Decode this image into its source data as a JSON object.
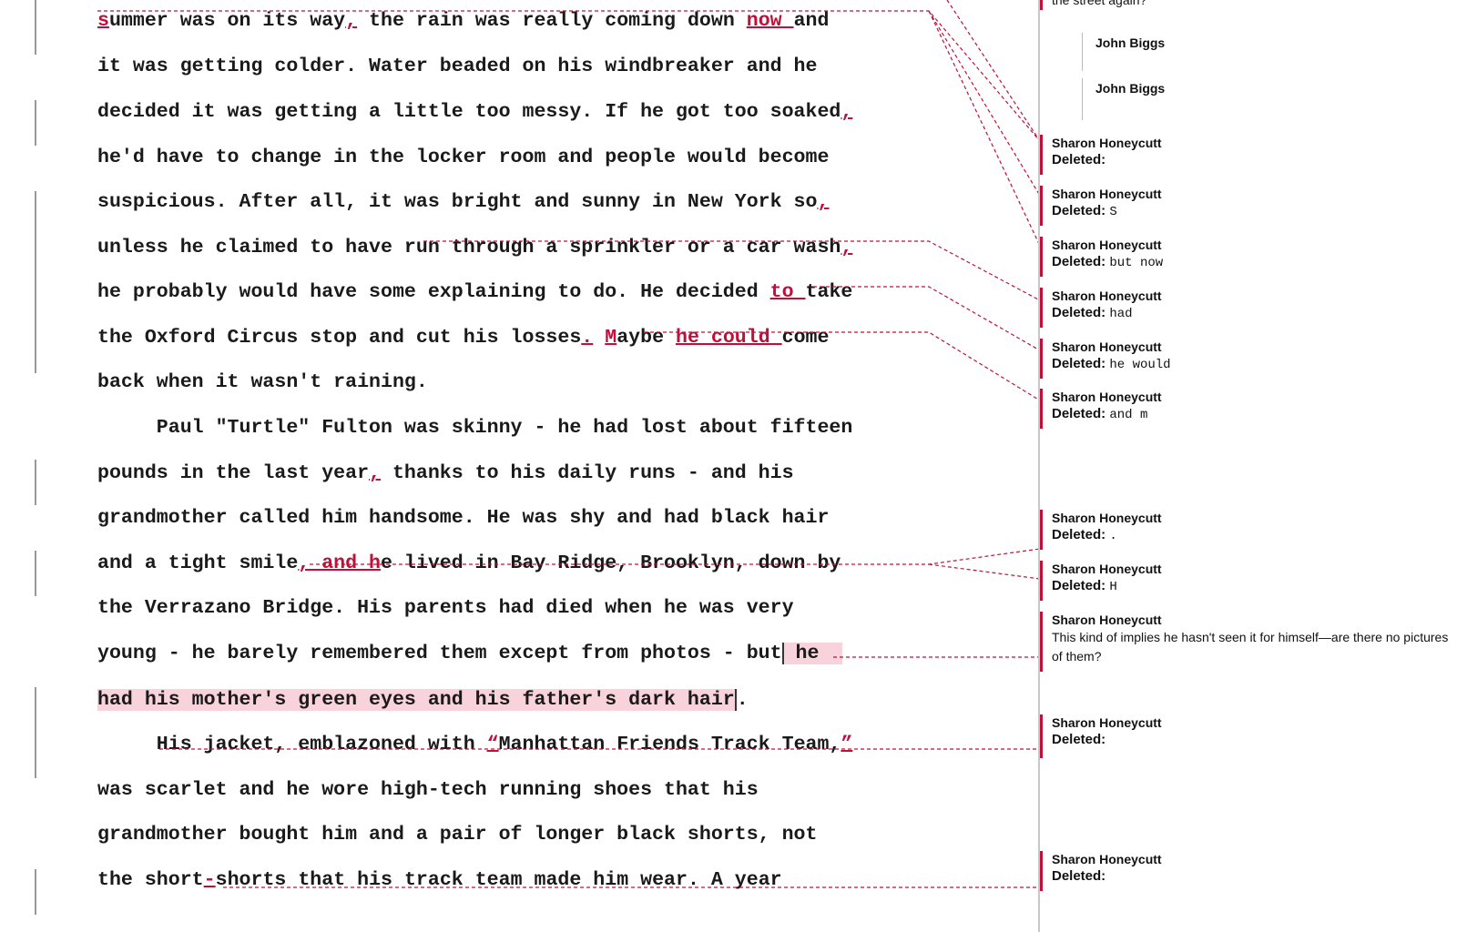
{
  "document": {
    "lines": [
      [
        {
          "t": "s",
          "ins": true
        },
        {
          "t": "ummer was on its way"
        },
        {
          "t": ",",
          "ins": true
        },
        {
          "t": " the rain was really coming down "
        },
        {
          "t": "now ",
          "ins": true
        },
        {
          "t": "and"
        }
      ],
      [
        {
          "t": "it was getting colder. Water beaded on his windbreaker and he"
        }
      ],
      [
        {
          "t": "decided it was getting a little too messy. If he got too soaked"
        },
        {
          "t": ",",
          "ins": true
        }
      ],
      [
        {
          "t": "he'd have to change in the locker room and people would become"
        }
      ],
      [
        {
          "t": "suspicious. After all, it was bright and sunny in New York so"
        },
        {
          "t": ",",
          "ins": true
        }
      ],
      [
        {
          "t": "unless he claimed to have run through a sprinkler or a car wash"
        },
        {
          "t": ",",
          "ins": true
        }
      ],
      [
        {
          "t": "he probably would have some explaining to do. He decided "
        },
        {
          "t": "to ",
          "ins": true
        },
        {
          "t": "take"
        }
      ],
      [
        {
          "t": "the Oxford Circus stop and cut his losses"
        },
        {
          "t": ".",
          "ins": true
        },
        {
          "t": " "
        },
        {
          "t": "M",
          "ins": true
        },
        {
          "t": "aybe "
        },
        {
          "t": "he could ",
          "ins": true
        },
        {
          "t": "come"
        }
      ],
      [
        {
          "t": "back when it wasn't raining."
        }
      ],
      [
        {
          "t": "     Paul \"Turtle\" Fulton was skinny - he had lost about fifteen"
        }
      ],
      [
        {
          "t": "pounds in the last year"
        },
        {
          "t": ",",
          "ins": true
        },
        {
          "t": " thanks to his daily runs - and his"
        }
      ],
      [
        {
          "t": "grandmother called him handsome. He was shy and had black hair"
        }
      ],
      [
        {
          "t": "and a tight smile"
        },
        {
          "t": ", and h",
          "ins": true
        },
        {
          "t": "e lived in Bay Ridge, Brooklyn, down by"
        }
      ],
      [
        {
          "t": "the Verrazano Bridge. His parents had died when he was very"
        }
      ],
      [
        {
          "t": "young - he barely remembered them except from photos - but"
        },
        {
          "t": " he  ",
          "hl": true,
          "cursor": true
        }
      ],
      [
        {
          "t": "had his mother's green eyes and his father's dark hair",
          "hl": true
        },
        {
          "t": ".",
          "cursor": true
        }
      ],
      [
        {
          "t": "     His jacket, emblazoned with "
        },
        {
          "t": "“",
          "ins": true
        },
        {
          "t": "Manhattan Friends Track Team,"
        },
        {
          "t": "”",
          "ins": true
        }
      ],
      [
        {
          "t": "was scarlet and he wore high-tech running shoes that his"
        }
      ],
      [
        {
          "t": "grandmother bought him and a pair of longer black shorts, not"
        }
      ],
      [
        {
          "t": "the short"
        },
        {
          "t": "-",
          "ins": true
        },
        {
          "t": "shorts that his track team made him wear. A year"
        }
      ]
    ]
  },
  "margin": {
    "top_comment_fragment": "the street again?",
    "replies": [
      "John Biggs",
      "John Biggs"
    ],
    "deleted_label": "Deleted:",
    "balloons": [
      {
        "author": "Sharon Honeycutt",
        "deleted": ""
      },
      {
        "author": "Sharon Honeycutt",
        "deleted": "S"
      },
      {
        "author": "Sharon Honeycutt",
        "deleted": "but now"
      },
      {
        "author": "Sharon Honeycutt",
        "deleted": "had"
      },
      {
        "author": "Sharon Honeycutt",
        "deleted": "he would"
      },
      {
        "author": "Sharon Honeycutt",
        "deleted": "and m"
      },
      {
        "author": "Sharon Honeycutt",
        "deleted": "."
      },
      {
        "author": "Sharon Honeycutt",
        "deleted": "H"
      },
      {
        "author": "Sharon Honeycutt",
        "comment": "This kind of implies he hasn't seen it for himself—are there no pictures of them?"
      },
      {
        "author": "Sharon Honeycutt",
        "deleted": ""
      },
      {
        "author": "Sharon Honeycutt",
        "deleted": ""
      }
    ]
  },
  "colors": {
    "revision": "#c0103a",
    "highlight": "#f9d3dc"
  }
}
